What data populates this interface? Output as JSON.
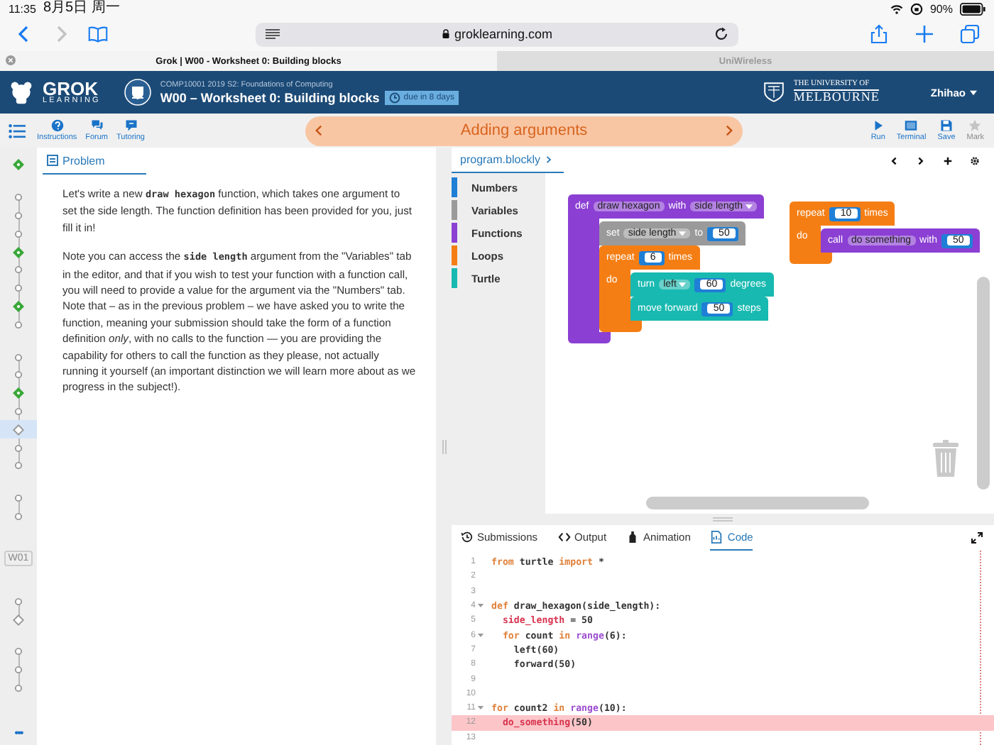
{
  "status_bar": {
    "time": "11:35",
    "date": "8月5日 周一",
    "battery": "90%"
  },
  "browser": {
    "url": "groklearning.com",
    "tabs": [
      {
        "title": "Grok | W00 - Worksheet 0: Building blocks",
        "selected": true
      },
      {
        "title": "UniWireless",
        "selected": false
      }
    ]
  },
  "header": {
    "logo": "GROK",
    "logo_sub": "LEARNING",
    "course": "COMP10001 2019 S2: Foundations of Computing",
    "title": "W00 – Worksheet 0: Building blocks",
    "due": "due in 8 days",
    "university_top": "THE UNIVERSITY OF",
    "university_name": "MELBOURNE",
    "user": "Zhihao"
  },
  "toolbar": {
    "left": [
      {
        "kind": "instructions",
        "label": "Instructions"
      },
      {
        "kind": "forum",
        "label": "Forum"
      },
      {
        "kind": "tutoring",
        "label": "Tutoring"
      }
    ],
    "problem_title": "Adding arguments",
    "right": [
      {
        "kind": "run",
        "label": "Run",
        "disabled": false
      },
      {
        "kind": "terminal",
        "label": "Terminal",
        "disabled": false
      },
      {
        "kind": "save",
        "label": "Save",
        "disabled": false
      },
      {
        "kind": "mark",
        "label": "Mark",
        "disabled": true
      }
    ]
  },
  "progress": [
    {
      "kind": "group",
      "items": [
        {
          "kind": "diamond",
          "done": true,
          "selected": false
        }
      ]
    },
    {
      "kind": "group",
      "items": [
        {
          "kind": "circle",
          "done": false,
          "selected": false
        },
        {
          "kind": "circle",
          "done": false,
          "selected": false
        },
        {
          "kind": "circle",
          "done": false,
          "selected": false
        },
        {
          "kind": "diamond",
          "done": true,
          "selected": false
        },
        {
          "kind": "circle",
          "done": false,
          "selected": false
        },
        {
          "kind": "circle",
          "done": false,
          "selected": false
        },
        {
          "kind": "diamond",
          "done": true,
          "selected": false
        },
        {
          "kind": "circle",
          "done": false,
          "selected": false
        }
      ]
    },
    {
      "kind": "group",
      "items": [
        {
          "kind": "circle",
          "done": false,
          "selected": false
        },
        {
          "kind": "circle",
          "done": false,
          "selected": false
        },
        {
          "kind": "diamond",
          "done": true,
          "selected": false
        },
        {
          "kind": "circle",
          "done": false,
          "selected": false
        },
        {
          "kind": "diamond",
          "done": false,
          "selected": true
        },
        {
          "kind": "circle",
          "done": false,
          "selected": false
        },
        {
          "kind": "circle",
          "done": false,
          "selected": false
        }
      ]
    },
    {
      "kind": "group",
      "items": [
        {
          "kind": "circle",
          "done": false,
          "selected": false
        },
        {
          "kind": "circle",
          "done": false,
          "selected": false
        }
      ]
    },
    {
      "kind": "week",
      "label": "W01"
    },
    {
      "kind": "group",
      "items": [
        {
          "kind": "circle",
          "done": false,
          "selected": false
        },
        {
          "kind": "diamond",
          "done": false,
          "selected": false
        }
      ]
    },
    {
      "kind": "group",
      "items": [
        {
          "kind": "circle",
          "done": false,
          "selected": false
        },
        {
          "kind": "circle",
          "done": false,
          "selected": false
        },
        {
          "kind": "circle",
          "done": false,
          "selected": false
        }
      ]
    }
  ],
  "progress_more": "•••",
  "problem": {
    "tab": "Problem",
    "paragraphs": [
      "Let's write a new **draw hexagon** function, which takes one argument to set the side length. The function definition has been provided for you, just fill it in!",
      "Note you can access the **side length** argument from the \"Variables\" tab in the editor, and that if you wish to test your function with a function call, you will need to provide a value for the argument via the \"Numbers\" tab. Note that – as in the previous problem – we have asked you to write the function, meaning your submission should take the form of a function definition *only*, with no calls to the function — you are providing the capability for others to call the function as they please, not actually running it yourself (an important distinction we will learn more about as we progress in the subject!)."
    ]
  },
  "editor": {
    "file_tab": "program.blockly",
    "toolbox": [
      {
        "kind": "numbers",
        "label": "Numbers",
        "color": "#1f7fd6"
      },
      {
        "kind": "variables",
        "label": "Variables",
        "color": "#9a9a9a"
      },
      {
        "kind": "functions",
        "label": "Functions",
        "color": "#8b3fd3"
      },
      {
        "kind": "loops",
        "label": "Loops",
        "color": "#f57e14"
      },
      {
        "kind": "turtle",
        "label": "Turtle",
        "color": "#18b9b0"
      }
    ],
    "stacks": [
      {
        "blocks": [
          {
            "kind": "functions",
            "tokens": [
              {
                "kind": "label",
                "text": "def"
              },
              {
                "kind": "field",
                "text": "draw hexagon"
              },
              {
                "kind": "label",
                "text": "with"
              },
              {
                "kind": "dropdown",
                "text": "side length"
              }
            ],
            "body": [
              {
                "kind": "variables",
                "tokens": [
                  {
                    "kind": "label",
                    "text": "set"
                  },
                  {
                    "kind": "dropdown",
                    "text": "side length"
                  },
                  {
                    "kind": "label",
                    "text": "to"
                  },
                  {
                    "kind": "number",
                    "text": "50"
                  }
                ]
              },
              {
                "kind": "loops",
                "tokens": [
                  {
                    "kind": "label",
                    "text": "repeat"
                  },
                  {
                    "kind": "number",
                    "text": "6"
                  },
                  {
                    "kind": "label",
                    "text": "times"
                  }
                ],
                "do_label": "do",
                "body": [
                  {
                    "kind": "turtle",
                    "tokens": [
                      {
                        "kind": "label",
                        "text": "turn"
                      },
                      {
                        "kind": "dropdown",
                        "text": "left"
                      },
                      {
                        "kind": "number",
                        "text": "60"
                      },
                      {
                        "kind": "label",
                        "text": "degrees"
                      }
                    ]
                  },
                  {
                    "kind": "turtle",
                    "tokens": [
                      {
                        "kind": "label",
                        "text": "move forward"
                      },
                      {
                        "kind": "number",
                        "text": "50"
                      },
                      {
                        "kind": "label",
                        "text": "steps"
                      }
                    ]
                  }
                ]
              }
            ]
          }
        ]
      },
      {
        "blocks": [
          {
            "kind": "loops",
            "tokens": [
              {
                "kind": "label",
                "text": "repeat"
              },
              {
                "kind": "number",
                "text": "10"
              },
              {
                "kind": "label",
                "text": "times"
              }
            ],
            "do_label": "do",
            "body": [
              {
                "kind": "functions",
                "tokens": [
                  {
                    "kind": "label",
                    "text": "call"
                  },
                  {
                    "kind": "field",
                    "text": "do something"
                  },
                  {
                    "kind": "label",
                    "text": "with"
                  },
                  {
                    "kind": "number",
                    "text": "50"
                  }
                ]
              }
            ]
          }
        ]
      }
    ]
  },
  "bottom_tabs": [
    {
      "kind": "submissions",
      "label": "Submissions",
      "selected": false
    },
    {
      "kind": "output",
      "label": "Output",
      "selected": false
    },
    {
      "kind": "animation",
      "label": "Animation",
      "selected": false
    },
    {
      "kind": "code",
      "label": "Code",
      "selected": true
    }
  ],
  "code_lines": [
    {
      "number": "1",
      "fold": false,
      "highlighted": false,
      "tokens": [
        {
          "kind": "keyword",
          "text": "from"
        },
        {
          "kind": "plain",
          "text": " turtle "
        },
        {
          "kind": "keyword",
          "text": "import"
        },
        {
          "kind": "plain",
          "text": " *"
        }
      ]
    },
    {
      "number": "2",
      "fold": false,
      "highlighted": false
    },
    {
      "number": "3",
      "fold": false,
      "highlighted": false
    },
    {
      "number": "4",
      "fold": true,
      "highlighted": false,
      "tokens": [
        {
          "kind": "keyword",
          "text": "def"
        },
        {
          "kind": "plain",
          "text": " draw_hexagon(side_length):"
        }
      ]
    },
    {
      "number": "5",
      "fold": false,
      "highlighted": false,
      "tokens": [
        {
          "kind": "name",
          "text": "  side_length"
        },
        {
          "kind": "plain",
          "text": " = 50"
        }
      ]
    },
    {
      "number": "6",
      "fold": true,
      "highlighted": false,
      "tokens": [
        {
          "kind": "keyword",
          "text": "  for"
        },
        {
          "kind": "plain",
          "text": " count "
        },
        {
          "kind": "keyword",
          "text": "in"
        },
        {
          "kind": "builtin",
          "text": " range"
        },
        {
          "kind": "plain",
          "text": "(6):"
        }
      ]
    },
    {
      "number": "7",
      "fold": false,
      "highlighted": false,
      "tokens": [
        {
          "kind": "plain",
          "text": "    left(60)"
        }
      ]
    },
    {
      "number": "8",
      "fold": false,
      "highlighted": false,
      "tokens": [
        {
          "kind": "plain",
          "text": "    forward(50)"
        }
      ]
    },
    {
      "number": "9",
      "fold": false,
      "highlighted": false
    },
    {
      "number": "10",
      "fold": false,
      "highlighted": false
    },
    {
      "number": "11",
      "fold": true,
      "highlighted": false,
      "tokens": [
        {
          "kind": "keyword",
          "text": "for"
        },
        {
          "kind": "plain",
          "text": " count2 "
        },
        {
          "kind": "keyword",
          "text": "in"
        },
        {
          "kind": "builtin",
          "text": " range"
        },
        {
          "kind": "plain",
          "text": "(10):"
        }
      ]
    },
    {
      "number": "12",
      "fold": false,
      "highlighted": true,
      "tokens": [
        {
          "kind": "name",
          "text": "  do_something"
        },
        {
          "kind": "plain",
          "text": "(50)"
        }
      ]
    },
    {
      "number": "13",
      "fold": false,
      "highlighted": false
    }
  ]
}
